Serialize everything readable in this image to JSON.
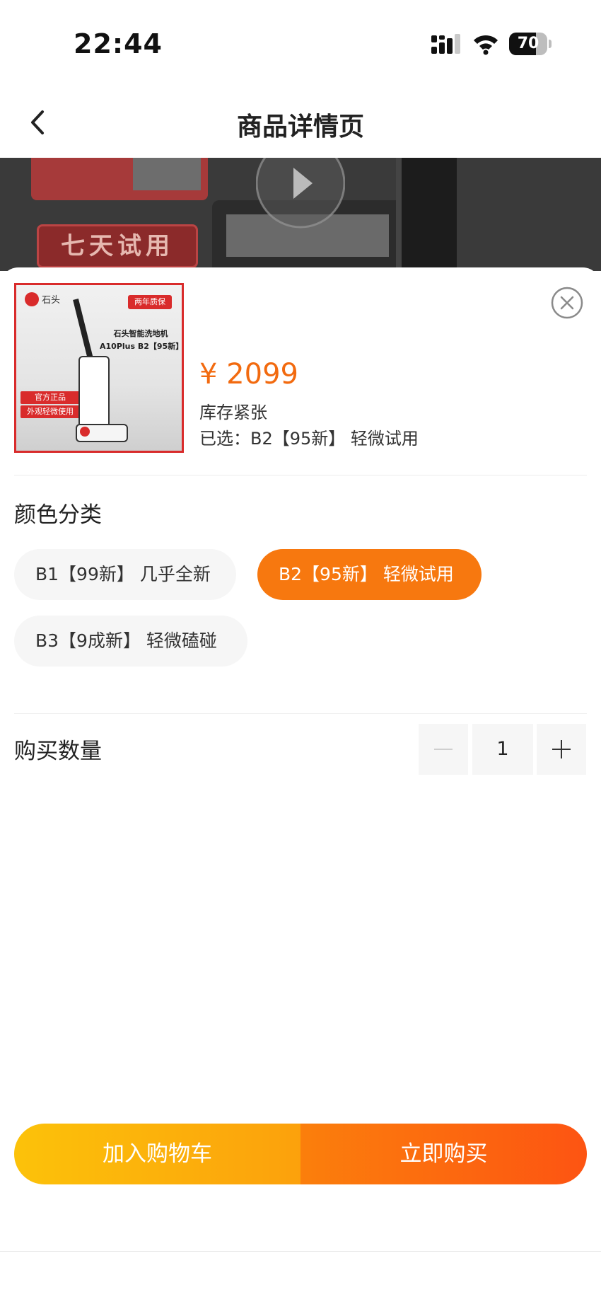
{
  "status_bar": {
    "time": "22:44",
    "battery_level": "70",
    "battery_fraction": 0.7,
    "icons": [
      "signal-icon",
      "wifi-icon",
      "battery-icon"
    ]
  },
  "header": {
    "title": "商品详情页",
    "back_icon": "chevron-left-icon"
  },
  "hero": {
    "badge_text": "七天试用",
    "play_icon": "play-icon"
  },
  "product": {
    "thumbnail": {
      "brand": "石头",
      "badge_top": "两年质保",
      "title_lines": [
        "石头智能洗地机",
        "A10Plus B2【95新】"
      ],
      "tag_lines": [
        "官方正品",
        "外观轻微使用"
      ]
    },
    "price": "¥ 2099",
    "stock_status": "库存紧张",
    "selected_label": "已选：",
    "selected_value": "B2【95新】 轻微试用"
  },
  "variants": {
    "title": "颜色分类",
    "options": [
      {
        "label": "B1【99新】 几乎全新",
        "selected": false
      },
      {
        "label": "B2【95新】 轻微试用",
        "selected": true
      },
      {
        "label": "B3【9成新】 轻微磕碰",
        "selected": false
      }
    ]
  },
  "quantity": {
    "title": "购买数量",
    "value": "1"
  },
  "actions": {
    "add_to_cart": "加入购物车",
    "buy_now": "立即购买"
  },
  "colors": {
    "accent": "#f7780f",
    "price": "#f26a0f",
    "cart_gradient": [
      "#fcc20a",
      "#fca10c"
    ],
    "buy_gradient": [
      "#fb7f0c",
      "#fd5412"
    ]
  }
}
